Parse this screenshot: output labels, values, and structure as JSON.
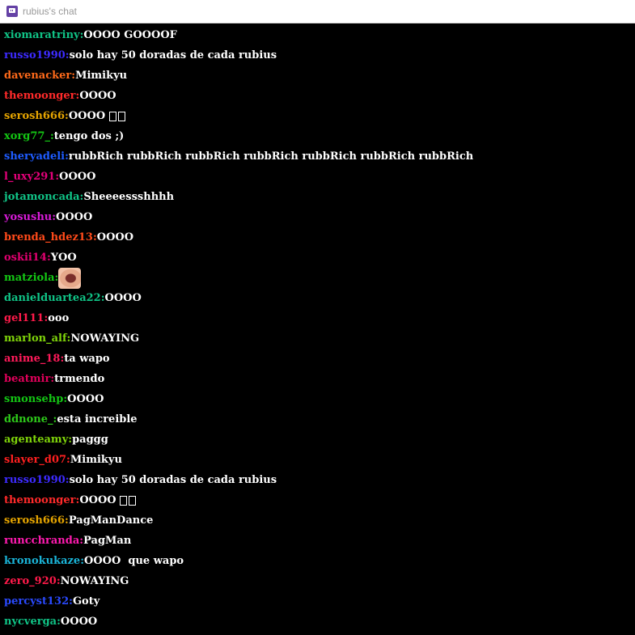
{
  "window": {
    "title": "rubius's chat"
  },
  "messages": [
    {
      "user": "xiomaratriny",
      "color": "#10c386",
      "text": "OOOO GOOOOF"
    },
    {
      "user": "russo1990",
      "color": "#3d2bff",
      "text": "solo hay 50 doradas de cada rubius"
    },
    {
      "user": "davenacker",
      "color": "#ff6a1a",
      "text": "Mimikyu"
    },
    {
      "user": "themoonger",
      "color": "#ff2a2a",
      "text": "OOOO"
    },
    {
      "user": "serosh666",
      "color": "#e5a400",
      "text": "OOOO",
      "boxes": 2
    },
    {
      "user": "xorg77_",
      "color": "#14c614",
      "text": "tengo dos ;)"
    },
    {
      "user": "sheryadeli",
      "color": "#1e5cff",
      "text": "rubbRich rubbRich rubbRich rubbRich rubbRich rubbRich rubbRich"
    },
    {
      "user": "l_uxy291",
      "color": "#e5007a",
      "text": "OOOO"
    },
    {
      "user": "jotamoncada",
      "color": "#10c386",
      "text": "Sheeeessshhhh"
    },
    {
      "user": "yosushu",
      "color": "#d81bd8",
      "text": "OOOO"
    },
    {
      "user": "brenda_hdez13",
      "color": "#ff4a1a",
      "text": "OOOO"
    },
    {
      "user": "oskii14",
      "color": "#e0006f",
      "text": "YOO"
    },
    {
      "user": "matziola",
      "color": "#14c614",
      "text": "",
      "emote": "lips-emote"
    },
    {
      "user": "danielduartea22",
      "color": "#10c386",
      "text": "OOOO"
    },
    {
      "user": "gel111",
      "color": "#ff1a4a",
      "text": "ooo"
    },
    {
      "user": "marlon_alf",
      "color": "#7fd40a",
      "text": "NOWAYING"
    },
    {
      "user": "anime_18",
      "color": "#ff1a5a",
      "text": "ta wapo"
    },
    {
      "user": "beatmir",
      "color": "#e0005a",
      "text": "trmendo"
    },
    {
      "user": "smonsehp",
      "color": "#14c614",
      "text": "OOOO"
    },
    {
      "user": "ddnone_",
      "color": "#2ec91a",
      "text": "esta increible"
    },
    {
      "user": "agenteamy",
      "color": "#7fd40a",
      "text": "paggg"
    },
    {
      "user": "slayer_d07",
      "color": "#ff2020",
      "text": "Mimikyu"
    },
    {
      "user": "russo1990",
      "color": "#3d2bff",
      "text": "solo hay 50 doradas de cada rubius"
    },
    {
      "user": "themoonger",
      "color": "#ff2a2a",
      "text": "OOOO",
      "boxes": 2
    },
    {
      "user": "serosh666",
      "color": "#e5a400",
      "text": "PagManDance"
    },
    {
      "user": "runcchranda",
      "color": "#ff1ab0",
      "text": "PagMan"
    },
    {
      "user": "kronokukaze",
      "color": "#1ab4d8",
      "text": "OOOO  que wapo"
    },
    {
      "user": "zero_920",
      "color": "#ff1a4a",
      "text": "NOWAYING"
    },
    {
      "user": "percyst132",
      "color": "#2a4aff",
      "text": "Goty"
    },
    {
      "user": "nycverga",
      "color": "#10c386",
      "text": "OOOO"
    }
  ]
}
